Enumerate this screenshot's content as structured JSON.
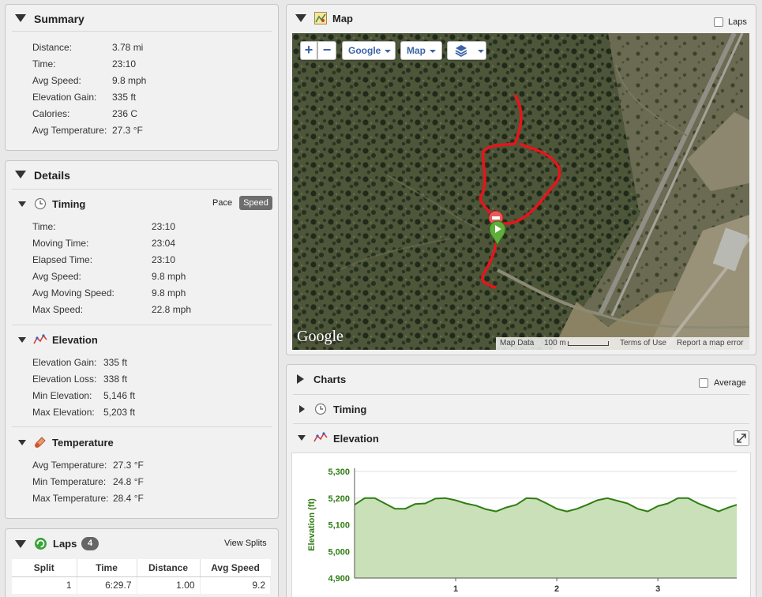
{
  "summary": {
    "title": "Summary",
    "rows": [
      {
        "label": "Distance:",
        "value": "3.78 mi"
      },
      {
        "label": "Time:",
        "value": "23:10"
      },
      {
        "label": "Avg Speed:",
        "value": "9.8 mph"
      },
      {
        "label": "Elevation Gain:",
        "value": "335 ft"
      },
      {
        "label": "Calories:",
        "value": "236 C"
      },
      {
        "label": "Avg Temperature:",
        "value": "27.3 °F"
      }
    ]
  },
  "details": {
    "title": "Details",
    "timing": {
      "title": "Timing",
      "pace_label": "Pace",
      "speed_label": "Speed",
      "rows": [
        {
          "label": "Time:",
          "value": "23:10"
        },
        {
          "label": "Moving Time:",
          "value": "23:04"
        },
        {
          "label": "Elapsed Time:",
          "value": "23:10"
        },
        {
          "label": "Avg Speed:",
          "value": "9.8 mph"
        },
        {
          "label": "Avg Moving Speed:",
          "value": "9.8 mph"
        },
        {
          "label": "Max Speed:",
          "value": "22.8 mph"
        }
      ]
    },
    "elevation": {
      "title": "Elevation",
      "rows": [
        {
          "label": "Elevation Gain:",
          "value": "335 ft"
        },
        {
          "label": "Elevation Loss:",
          "value": "338 ft"
        },
        {
          "label": "Min Elevation:",
          "value": "5,146 ft"
        },
        {
          "label": "Max Elevation:",
          "value": "5,203 ft"
        }
      ]
    },
    "temperature": {
      "title": "Temperature",
      "rows": [
        {
          "label": "Avg Temperature:",
          "value": "27.3 °F"
        },
        {
          "label": "Min Temperature:",
          "value": "24.8 °F"
        },
        {
          "label": "Max Temperature:",
          "value": "28.4 °F"
        }
      ]
    }
  },
  "laps": {
    "title": "Laps",
    "count": "4",
    "view_splits": "View Splits",
    "columns": [
      "Split",
      "Time",
      "Distance",
      "Avg Speed"
    ],
    "rows": [
      [
        "1",
        "6:29.7",
        "1.00",
        "9.2"
      ]
    ]
  },
  "map": {
    "title": "Map",
    "laps_label": "Laps",
    "zoom_in": "+",
    "zoom_out": "−",
    "provider_button": "Google",
    "type_button": "Map",
    "google_logo": "Google",
    "attribution": {
      "map_data": "Map Data",
      "scale": "100 m",
      "terms": "Terms of Use",
      "report": "Report a map error"
    },
    "route_color": "#e8141b"
  },
  "charts": {
    "title": "Charts",
    "average_label": "Average",
    "timing_title": "Timing",
    "elevation_title": "Elevation"
  },
  "chart_data": {
    "type": "area",
    "ylabel": "Elevation (ft)",
    "ylim": [
      4900,
      5300
    ],
    "yticks": [
      "5,300",
      "5,200",
      "5,100",
      "5,000",
      "4,900"
    ],
    "xticks": [
      "1",
      "2",
      "3"
    ],
    "xlim": [
      0,
      3.78
    ],
    "color": "#2e7d12",
    "fill": "#c9e0b8",
    "x": [
      0,
      0.1,
      0.2,
      0.3,
      0.4,
      0.5,
      0.6,
      0.7,
      0.8,
      0.9,
      1.0,
      1.1,
      1.2,
      1.3,
      1.4,
      1.5,
      1.6,
      1.7,
      1.8,
      1.9,
      2.0,
      2.1,
      2.2,
      2.3,
      2.4,
      2.5,
      2.6,
      2.7,
      2.8,
      2.9,
      3.0,
      3.1,
      3.2,
      3.3,
      3.4,
      3.5,
      3.6,
      3.7,
      3.78
    ],
    "y": [
      5175,
      5200,
      5200,
      5180,
      5160,
      5160,
      5178,
      5180,
      5198,
      5200,
      5192,
      5180,
      5172,
      5158,
      5150,
      5165,
      5175,
      5200,
      5198,
      5180,
      5160,
      5150,
      5160,
      5175,
      5192,
      5200,
      5190,
      5180,
      5160,
      5150,
      5170,
      5180,
      5200,
      5200,
      5180,
      5165,
      5150,
      5165,
      5175
    ]
  }
}
